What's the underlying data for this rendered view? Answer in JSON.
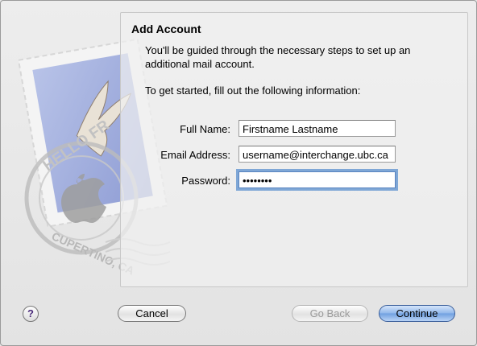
{
  "dialog": {
    "title": "Add Account",
    "intro": "You'll be guided through the necessary steps to set up an additional mail account.",
    "instruction": "To get started, fill out the following information:"
  },
  "form": {
    "full_name_label": "Full Name:",
    "full_name_value": "Firstname Lastname",
    "email_label": "Email Address:",
    "email_value": "username@interchange.ubc.ca",
    "password_label": "Password:",
    "password_value": "••••••••"
  },
  "stamp": {
    "text_top": "HELLO FR",
    "text_bottom": "CUPERTINO, CA"
  },
  "buttons": {
    "help": "?",
    "cancel": "Cancel",
    "go_back": "Go Back",
    "continue": "Continue"
  },
  "colors": {
    "focus_ring": "#7fa7d6",
    "default_button": "#6f9fe0",
    "help_glyph": "#4a2a7a"
  }
}
